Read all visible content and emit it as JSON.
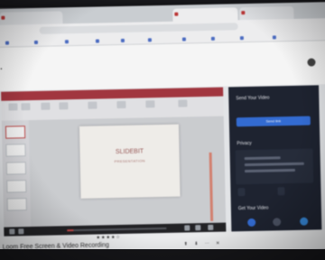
{
  "browser": {
    "tabs": [
      "",
      "",
      ""
    ],
    "url": "",
    "bookmarks": [
      "",
      "",
      "",
      "",
      "",
      "",
      "",
      "",
      "",
      ""
    ]
  },
  "header": {
    "buttons": [
      "",
      "",
      ""
    ]
  },
  "slide": {
    "title": "SLIDEBIT",
    "subtitle": "PRESENTATION"
  },
  "panel": {
    "send_title": "Send Your Video",
    "send_button": "Send link",
    "privacy_title": "Privacy",
    "privacy_buttons": [
      "",
      ""
    ],
    "get_title": "Get Your Video"
  },
  "progress": {
    "fraction": 0.06
  },
  "bottom": {
    "stars": "★★★★☆",
    "title": "Loom Free Screen & Video Recording"
  },
  "colors": {
    "accent": "#d94b4b",
    "panel_bg": "#1e2433",
    "send_button": "#2f6fe4"
  }
}
